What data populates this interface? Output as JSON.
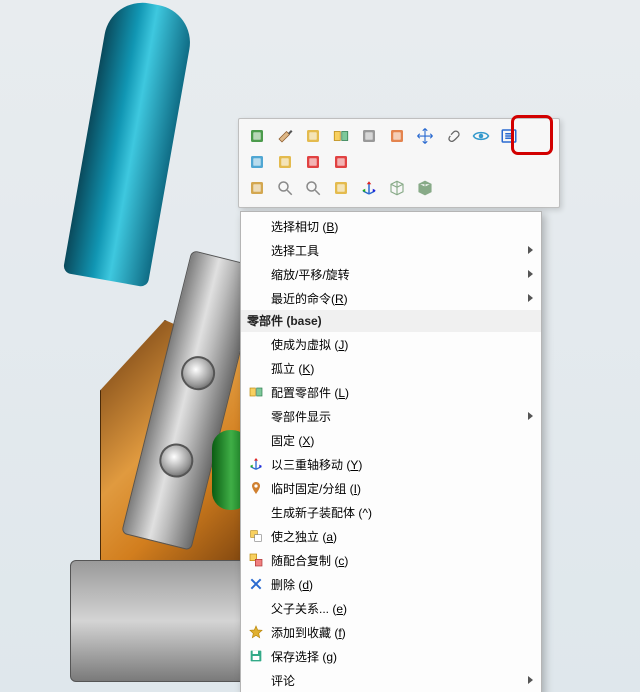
{
  "toolbar": {
    "rows": [
      [
        "edit-part",
        "paint",
        "properties",
        "config",
        "measure",
        "appearance",
        "move",
        "attach",
        "hide",
        "list"
      ],
      [
        "isolate",
        "sketch",
        "colors-a",
        "colors-b"
      ],
      [
        "copy",
        "zoom-window",
        "zoom-fit",
        "section",
        "triad",
        "box",
        "shaded"
      ]
    ],
    "highlighted": "list"
  },
  "menu": {
    "sections": [
      {
        "items": [
          {
            "label": "选择相切 (B)",
            "shortcut": "B",
            "icon": null,
            "submenu": false
          },
          {
            "label": "选择工具",
            "icon": null,
            "submenu": true
          },
          {
            "label": "缩放/平移/旋转",
            "icon": null,
            "submenu": true
          },
          {
            "label": "最近的命令(R)",
            "shortcut": "R",
            "icon": null,
            "submenu": true
          }
        ]
      },
      {
        "header": "零部件 (base)",
        "items": [
          {
            "label": "使成为虚拟 (J)",
            "shortcut": "J",
            "icon": null
          },
          {
            "label": "孤立 (K)",
            "shortcut": "K",
            "icon": null
          },
          {
            "label": "配置零部件 (L)",
            "shortcut": "L",
            "icon": "config"
          },
          {
            "label": "零部件显示",
            "icon": null,
            "submenu": true
          },
          {
            "label": "固定 (X)",
            "shortcut": "X",
            "icon": null
          },
          {
            "label": "以三重轴移动 (Y)",
            "shortcut": "Y",
            "icon": "triad"
          },
          {
            "label": "临时固定/分组 (I)",
            "shortcut": "I",
            "icon": "pin"
          },
          {
            "label": "生成新子装配体 (^)",
            "icon": null
          },
          {
            "label": "使之独立 (a)",
            "shortcut": "a",
            "icon": "independent"
          },
          {
            "label": "随配合复制 (c)",
            "shortcut": "c",
            "icon": "copy-mates"
          },
          {
            "label": "删除 (d)",
            "shortcut": "d",
            "icon": "delete"
          },
          {
            "label": "父子关系... (e)",
            "shortcut": "e",
            "icon": null
          },
          {
            "label": "添加到收藏 (f)",
            "shortcut": "f",
            "icon": "star"
          },
          {
            "label": "保存选择 (g)",
            "shortcut": "g",
            "icon": "save"
          },
          {
            "label": "评论",
            "icon": null,
            "submenu": true
          }
        ]
      }
    ]
  },
  "icons": {
    "edit-part": "#2e8b2e",
    "paint": "#caa",
    "properties": "#e0b030",
    "config": "#3a8",
    "measure": "#888",
    "appearance": "#e07030",
    "move": "#2a6ad0",
    "attach": "#666",
    "hide": "#39c",
    "list": "#2a6ad0",
    "isolate": "#39c",
    "sketch": "#e0b030",
    "colors-a": "#d22",
    "colors-b": "#d22",
    "copy": "#c93",
    "zoom-window": "#888",
    "zoom-fit": "#888",
    "section": "#e0b030",
    "triad": "#2a6ad0",
    "box": "#8a8",
    "shaded": "#8a8",
    "config-mi": "#3a8",
    "pin": "#d08030",
    "independent": "#e0b030",
    "copy-mates": "#d04848",
    "delete": "#2a6ad0",
    "star": "#e0b030",
    "save": "#3a8"
  }
}
